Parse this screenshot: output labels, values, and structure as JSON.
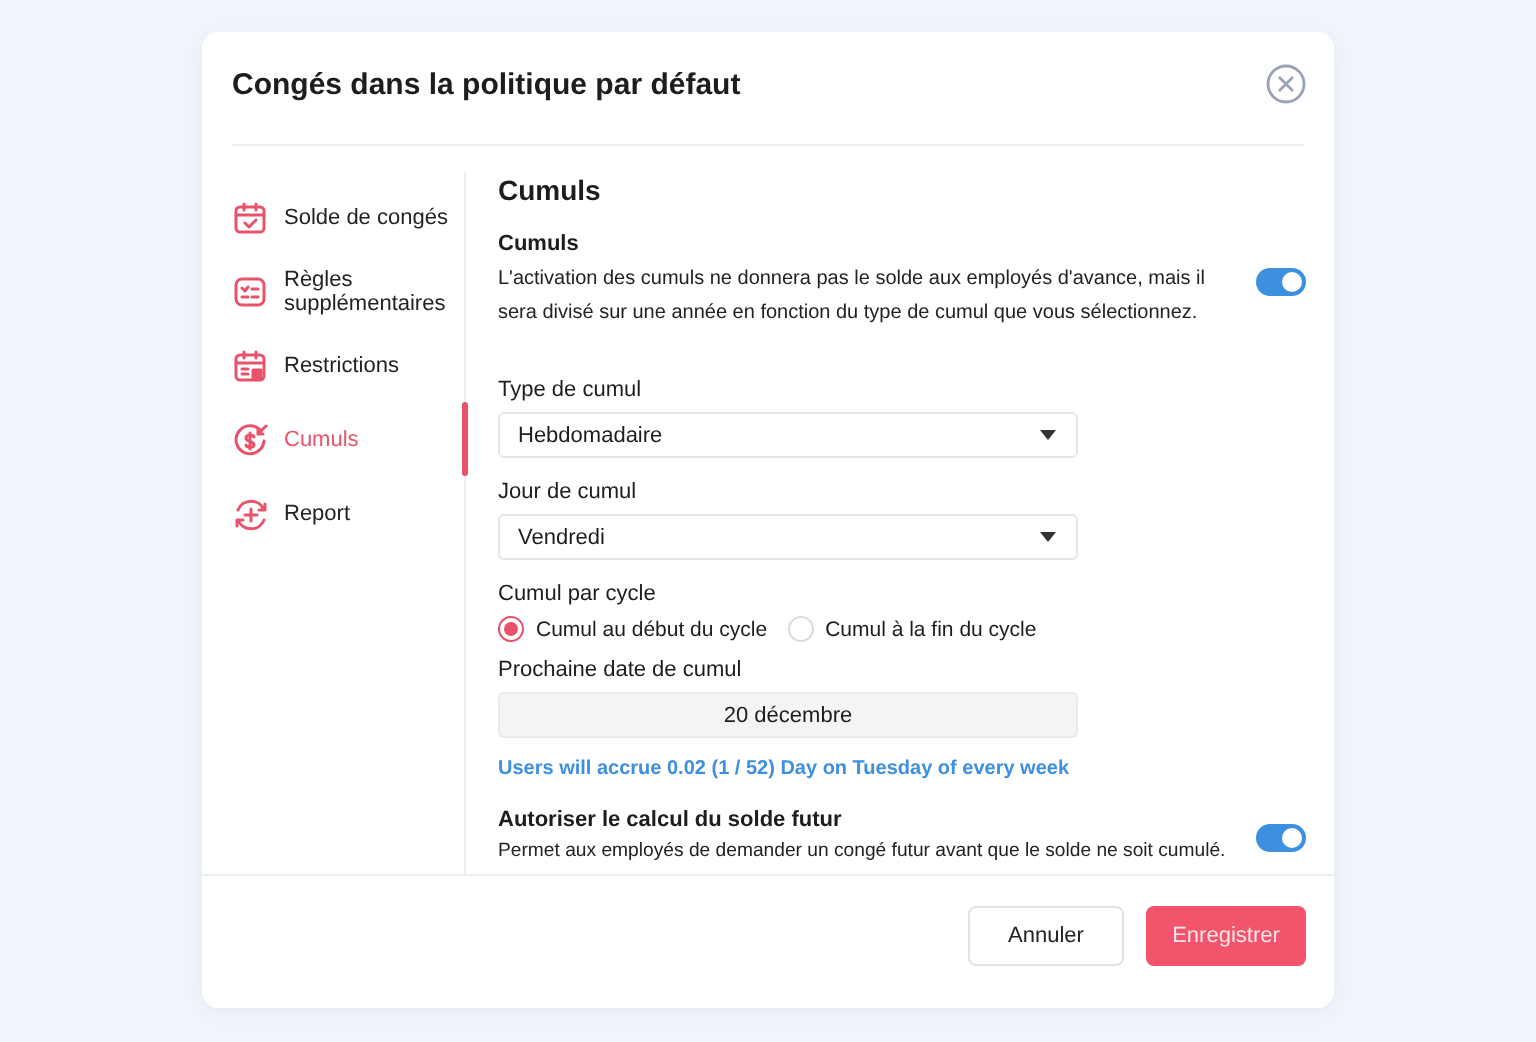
{
  "dialog": {
    "title": "Congés dans la politique par défaut"
  },
  "sidebar": {
    "items": [
      {
        "label": "Solde de congés",
        "selected": false
      },
      {
        "label": "Règles supplémentaires",
        "selected": false
      },
      {
        "label": "Restrictions",
        "selected": false
      },
      {
        "label": "Cumuls",
        "selected": true
      },
      {
        "label": "Report",
        "selected": false
      }
    ]
  },
  "content": {
    "heading": "Cumuls",
    "accrual_setting": {
      "title": "Cumuls",
      "description": "L'activation des cumuls ne donnera pas le solde aux employés d'avance, mais il sera divisé sur une année en fonction du type de cumul que vous sélectionnez.",
      "on": true
    },
    "fields": [
      {
        "label": "Type de cumul",
        "value": "Hebdomadaire"
      },
      {
        "label": "Jour de cumul",
        "value": "Vendredi"
      }
    ],
    "cycle": {
      "label": "Cumul par cycle",
      "options": [
        {
          "label": "Cumul au début du cycle",
          "selected": true
        },
        {
          "label": "Cumul à la fin du cycle",
          "selected": false
        }
      ]
    },
    "next_date": {
      "label": "Prochaine date de cumul",
      "value": "20 décembre"
    },
    "info": "Users will accrue 0.02 (1 / 52) Day on Tuesday of every week",
    "future_setting": {
      "title": "Autoriser le calcul du solde futur",
      "description": "Permet aux employés de demander un congé futur avant que le solde ne soit cumulé.",
      "on": true
    }
  },
  "buttons": [
    {
      "label": "Annuler",
      "kind": "secondary"
    },
    {
      "label": "Enregistrer",
      "kind": "primary"
    }
  ]
}
